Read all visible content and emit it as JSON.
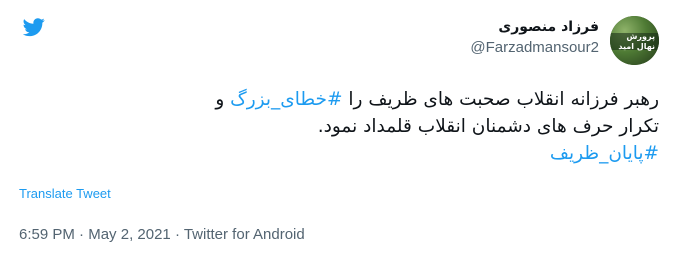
{
  "tweet": {
    "author": {
      "display_name": "فرزاد منصوری",
      "handle": "@Farzadmansour2",
      "avatar_text_line1": "پرورش",
      "avatar_text_line2": "نهال امید"
    },
    "text": {
      "line1_prefix": "رهبر فرزانه انقلاب صحبت های ظریف را ",
      "line1_hashtag": "#خطای_بزرگ",
      "line1_suffix": " و",
      "line2": "تکرار حرف های دشمنان انقلاب قلمداد نمود.",
      "line3_hashtag": "#پایان_ظریف"
    },
    "translate_label": "Translate Tweet",
    "meta": {
      "time": "6:59 PM",
      "sep1": " · ",
      "date": "May 2, 2021",
      "sep2": " · ",
      "source": "Twitter for Android"
    }
  },
  "colors": {
    "link": "#1d9bf0",
    "text": "#0f1419",
    "secondary": "#536471"
  },
  "icons": {
    "logo": "twitter-bird-icon"
  }
}
